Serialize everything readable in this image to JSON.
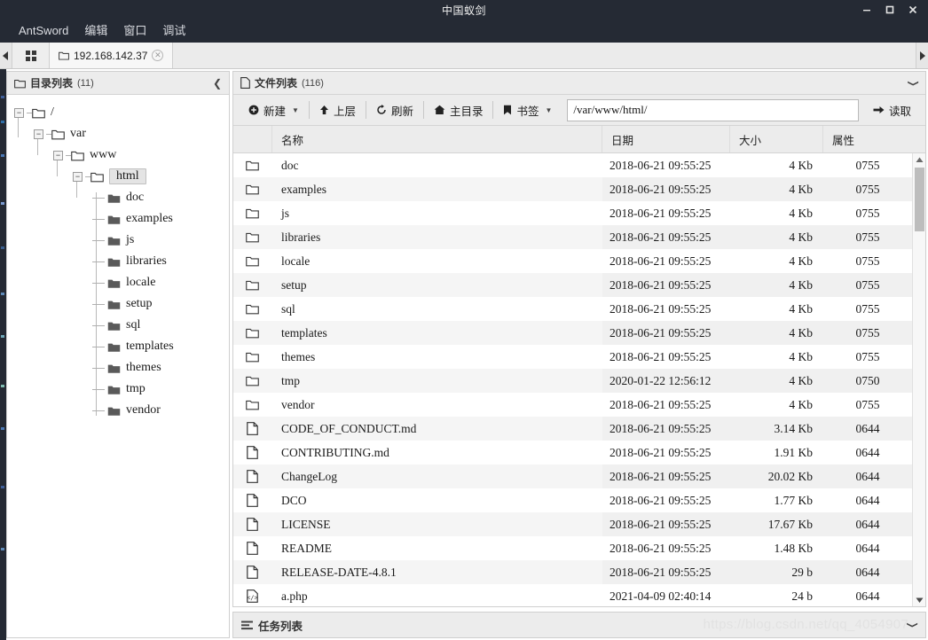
{
  "window": {
    "title": "中国蚁剑",
    "controls": {
      "minimize": "minimize-icon",
      "maximize": "maximize-icon",
      "close": "close-icon"
    }
  },
  "menubar": {
    "items": [
      {
        "label": "AntSword"
      },
      {
        "label": "编辑"
      },
      {
        "label": "窗口"
      },
      {
        "label": "调试"
      }
    ]
  },
  "tabbar": {
    "scroll_left": "◀",
    "scroll_right": "▶",
    "grid_button": "grid-icon",
    "tabs": [
      {
        "label": "192.168.142.37",
        "close": "✕",
        "active": true
      }
    ]
  },
  "dir_panel": {
    "title": "目录列表",
    "count": "(11)",
    "collapse_icon": "❮",
    "tree": [
      {
        "label": "/",
        "depth": 0,
        "expandable": true,
        "expanded": true,
        "selected": false
      },
      {
        "label": "var",
        "depth": 1,
        "expandable": true,
        "expanded": true,
        "selected": false
      },
      {
        "label": "www",
        "depth": 2,
        "expandable": true,
        "expanded": true,
        "selected": false
      },
      {
        "label": "html",
        "depth": 3,
        "expandable": true,
        "expanded": true,
        "selected": true
      },
      {
        "label": "doc",
        "depth": 4,
        "expandable": false,
        "expanded": false,
        "selected": false
      },
      {
        "label": "examples",
        "depth": 4,
        "expandable": false,
        "expanded": false,
        "selected": false
      },
      {
        "label": "js",
        "depth": 4,
        "expandable": false,
        "expanded": false,
        "selected": false
      },
      {
        "label": "libraries",
        "depth": 4,
        "expandable": false,
        "expanded": false,
        "selected": false
      },
      {
        "label": "locale",
        "depth": 4,
        "expandable": false,
        "expanded": false,
        "selected": false
      },
      {
        "label": "setup",
        "depth": 4,
        "expandable": false,
        "expanded": false,
        "selected": false
      },
      {
        "label": "sql",
        "depth": 4,
        "expandable": false,
        "expanded": false,
        "selected": false
      },
      {
        "label": "templates",
        "depth": 4,
        "expandable": false,
        "expanded": false,
        "selected": false
      },
      {
        "label": "themes",
        "depth": 4,
        "expandable": false,
        "expanded": false,
        "selected": false
      },
      {
        "label": "tmp",
        "depth": 4,
        "expandable": false,
        "expanded": false,
        "selected": false
      },
      {
        "label": "vendor",
        "depth": 4,
        "expandable": false,
        "expanded": false,
        "selected": false
      }
    ]
  },
  "file_panel": {
    "title": "文件列表",
    "count": "(116)",
    "collapse_icon": "❭",
    "toolbar": {
      "new_label": "新建",
      "up_label": "上层",
      "refresh_label": "刷新",
      "home_label": "主目录",
      "bookmark_label": "书签",
      "caret": "▼",
      "path_value": "/var/www/html/",
      "path_placeholder": "/var/www/html/",
      "read_label": "读取"
    },
    "columns": [
      "",
      "名称",
      "日期",
      "大小",
      "属性"
    ],
    "rows": [
      {
        "icon": "folder",
        "name": "doc",
        "date": "2018-06-21 09:55:25",
        "size": "4 Kb",
        "attr": "0755"
      },
      {
        "icon": "folder",
        "name": "examples",
        "date": "2018-06-21 09:55:25",
        "size": "4 Kb",
        "attr": "0755"
      },
      {
        "icon": "folder",
        "name": "js",
        "date": "2018-06-21 09:55:25",
        "size": "4 Kb",
        "attr": "0755"
      },
      {
        "icon": "folder",
        "name": "libraries",
        "date": "2018-06-21 09:55:25",
        "size": "4 Kb",
        "attr": "0755"
      },
      {
        "icon": "folder",
        "name": "locale",
        "date": "2018-06-21 09:55:25",
        "size": "4 Kb",
        "attr": "0755"
      },
      {
        "icon": "folder",
        "name": "setup",
        "date": "2018-06-21 09:55:25",
        "size": "4 Kb",
        "attr": "0755"
      },
      {
        "icon": "folder",
        "name": "sql",
        "date": "2018-06-21 09:55:25",
        "size": "4 Kb",
        "attr": "0755"
      },
      {
        "icon": "folder",
        "name": "templates",
        "date": "2018-06-21 09:55:25",
        "size": "4 Kb",
        "attr": "0755"
      },
      {
        "icon": "folder",
        "name": "themes",
        "date": "2018-06-21 09:55:25",
        "size": "4 Kb",
        "attr": "0755"
      },
      {
        "icon": "folder",
        "name": "tmp",
        "date": "2020-01-22 12:56:12",
        "size": "4 Kb",
        "attr": "0750"
      },
      {
        "icon": "folder",
        "name": "vendor",
        "date": "2018-06-21 09:55:25",
        "size": "4 Kb",
        "attr": "0755"
      },
      {
        "icon": "file",
        "name": "CODE_OF_CONDUCT.md",
        "date": "2018-06-21 09:55:25",
        "size": "3.14 Kb",
        "attr": "0644"
      },
      {
        "icon": "file",
        "name": "CONTRIBUTING.md",
        "date": "2018-06-21 09:55:25",
        "size": "1.91 Kb",
        "attr": "0644"
      },
      {
        "icon": "file",
        "name": "ChangeLog",
        "date": "2018-06-21 09:55:25",
        "size": "20.02 Kb",
        "attr": "0644"
      },
      {
        "icon": "file",
        "name": "DCO",
        "date": "2018-06-21 09:55:25",
        "size": "1.77 Kb",
        "attr": "0644"
      },
      {
        "icon": "file",
        "name": "LICENSE",
        "date": "2018-06-21 09:55:25",
        "size": "17.67 Kb",
        "attr": "0644"
      },
      {
        "icon": "file",
        "name": "README",
        "date": "2018-06-21 09:55:25",
        "size": "1.48 Kb",
        "attr": "0644"
      },
      {
        "icon": "file",
        "name": "RELEASE-DATE-4.8.1",
        "date": "2018-06-21 09:55:25",
        "size": "29 b",
        "attr": "0644"
      },
      {
        "icon": "code",
        "name": "a.php",
        "date": "2021-04-09 02:40:14",
        "size": "24 b",
        "attr": "0644"
      }
    ]
  },
  "taskbar": {
    "title": "任务列表",
    "collapse_icon": "❭"
  },
  "watermark": "https://blog.csdn.net/qq_4054907",
  "colors": {
    "titlebar_bg": "#252a34",
    "panel_header_bg": "#ececec",
    "row_alt_bg": "#f5f5f5",
    "folder_icon": "#5a5a5a",
    "border": "#cfcfcf"
  }
}
